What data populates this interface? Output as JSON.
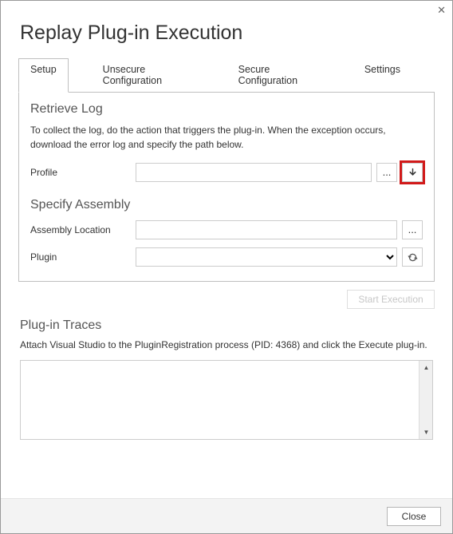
{
  "dialog": {
    "title": "Replay Plug-in Execution"
  },
  "tabs": {
    "setup": "Setup",
    "unsecure": "Unsecure Configuration",
    "secure": "Secure Configuration",
    "settings": "Settings"
  },
  "retrieve_log": {
    "title": "Retrieve Log",
    "desc": "To collect the log, do the action that triggers the plug-in. When the exception occurs, download the error log and specify the path below.",
    "profile_label": "Profile",
    "profile_value": "",
    "browse_label": "...",
    "download_icon": "download-icon"
  },
  "specify_assembly": {
    "title": "Specify Assembly",
    "location_label": "Assembly Location",
    "location_value": "",
    "browse_label": "...",
    "plugin_label": "Plugin",
    "plugin_value": "",
    "refresh_icon": "refresh-icon"
  },
  "actions": {
    "start_execution": "Start Execution"
  },
  "traces": {
    "title": "Plug-in Traces",
    "desc": "Attach Visual Studio to the PluginRegistration process (PID: 4368) and click the Execute plug-in.",
    "content": ""
  },
  "footer": {
    "close": "Close"
  }
}
